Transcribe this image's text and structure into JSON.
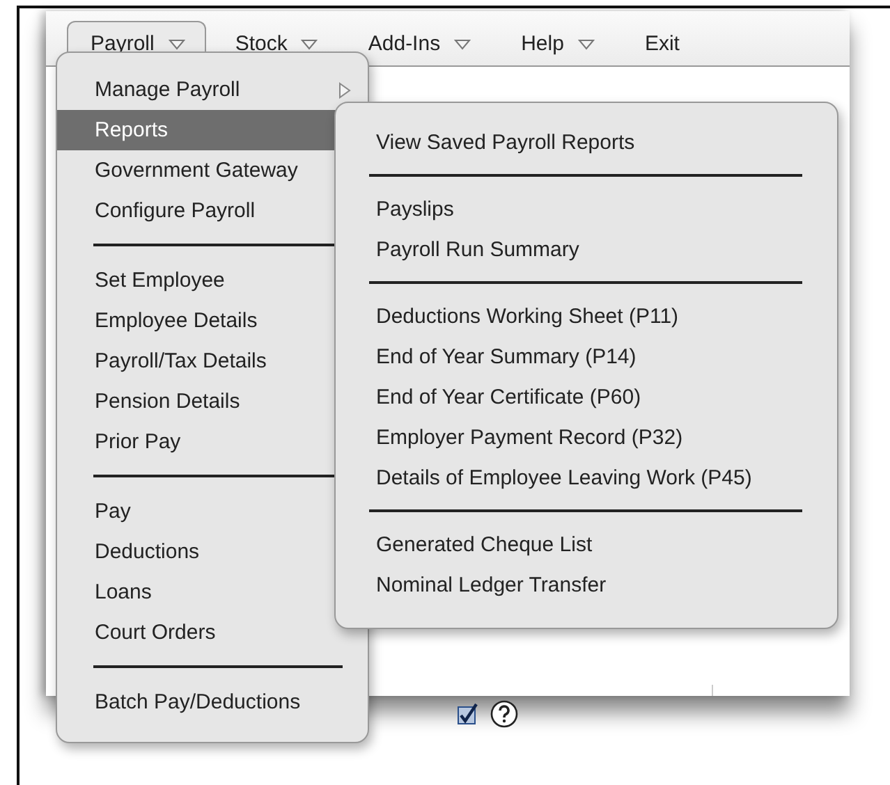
{
  "menubar": [
    {
      "label": "Payroll",
      "kind": "dropdown",
      "selected": true
    },
    {
      "label": "Stock",
      "kind": "dropdown",
      "selected": false
    },
    {
      "label": "Add-Ins",
      "kind": "dropdown",
      "selected": false
    },
    {
      "label": "Help",
      "kind": "dropdown",
      "selected": false
    },
    {
      "label": "Exit",
      "kind": "plain",
      "selected": false
    }
  ],
  "payroll_menu": [
    {
      "kind": "item",
      "label": "Manage Payroll",
      "submenu": true,
      "selected": false
    },
    {
      "kind": "item",
      "label": "Reports",
      "submenu": false,
      "selected": true
    },
    {
      "kind": "item",
      "label": "Government Gateway",
      "submenu": false,
      "selected": false
    },
    {
      "kind": "item",
      "label": "Configure Payroll",
      "submenu": false,
      "selected": false
    },
    {
      "kind": "separator"
    },
    {
      "kind": "item",
      "label": "Set Employee",
      "submenu": false,
      "selected": false
    },
    {
      "kind": "item",
      "label": "Employee Details",
      "submenu": false,
      "selected": false
    },
    {
      "kind": "item",
      "label": "Payroll/Tax Details",
      "submenu": false,
      "selected": false
    },
    {
      "kind": "item",
      "label": "Pension Details",
      "submenu": false,
      "selected": false
    },
    {
      "kind": "item",
      "label": "Prior Pay",
      "submenu": false,
      "selected": false
    },
    {
      "kind": "separator"
    },
    {
      "kind": "item",
      "label": "Pay",
      "submenu": false,
      "selected": false
    },
    {
      "kind": "item",
      "label": "Deductions",
      "submenu": false,
      "selected": false
    },
    {
      "kind": "item",
      "label": "Loans",
      "submenu": false,
      "selected": false
    },
    {
      "kind": "item",
      "label": "Court Orders",
      "submenu": false,
      "selected": false
    },
    {
      "kind": "separator"
    },
    {
      "kind": "item",
      "label": "Batch Pay/Deductions",
      "submenu": false,
      "selected": false
    }
  ],
  "reports_menu": [
    {
      "kind": "item",
      "label": "View Saved Payroll Reports"
    },
    {
      "kind": "separator"
    },
    {
      "kind": "item",
      "label": "Payslips"
    },
    {
      "kind": "item",
      "label": "Payroll Run Summary"
    },
    {
      "kind": "separator"
    },
    {
      "kind": "item",
      "label": "Deductions Working Sheet (P11)"
    },
    {
      "kind": "item",
      "label": "End of Year Summary (P14)"
    },
    {
      "kind": "item",
      "label": "End of Year Certificate (P60)"
    },
    {
      "kind": "item",
      "label": "Employer Payment Record (P32)"
    },
    {
      "kind": "item",
      "label": "Details of Employee Leaving Work (P45)"
    },
    {
      "kind": "separator"
    },
    {
      "kind": "item",
      "label": "Generated Cheque List"
    },
    {
      "kind": "item",
      "label": "Nominal Ledger Transfer"
    }
  ],
  "form": {
    "checkbox": {
      "checked": true
    }
  }
}
